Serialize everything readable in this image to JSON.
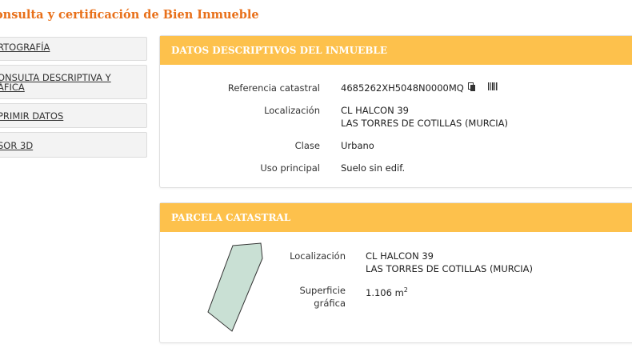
{
  "page_title": "onsulta y certificación de Bien Inmueble",
  "sidebar": {
    "items": [
      {
        "label": "RTOGRAFÍA"
      },
      {
        "label_line1": "ONSULTA DESCRIPTIVA Y",
        "label_line2": "ÁFICA"
      },
      {
        "label": "PRIMIR DATOS"
      },
      {
        "label": "SOR 3D"
      }
    ]
  },
  "datos": {
    "header": "DATOS DESCRIPTIVOS DEL INMUEBLE",
    "ref_label": "Referencia catastral",
    "ref_value": "4685262XH5048N0000MQ",
    "loc_label": "Localización",
    "loc_line1": "CL HALCON 39",
    "loc_line2": "LAS TORRES DE COTILLAS (MURCIA)",
    "clase_label": "Clase",
    "clase_value": "Urbano",
    "uso_label": "Uso principal",
    "uso_value": "Suelo sin edif."
  },
  "parcela": {
    "header": "PARCELA CATASTRAL",
    "loc_label": "Localización",
    "loc_line1": "CL HALCON 39",
    "loc_line2": "LAS TORRES DE COTILLAS (MURCIA)",
    "sup_label_line1": "Superficie",
    "sup_label_line2": "gráfica",
    "sup_value": "1.106 m",
    "sup_unit_sup": "2"
  },
  "icons": {
    "copy": "copy-icon",
    "barcode": "barcode-icon"
  },
  "colors": {
    "accent_orange": "#e8701a",
    "header_yellow": "#fdc14c",
    "parcel_fill": "#c9e0d4"
  }
}
